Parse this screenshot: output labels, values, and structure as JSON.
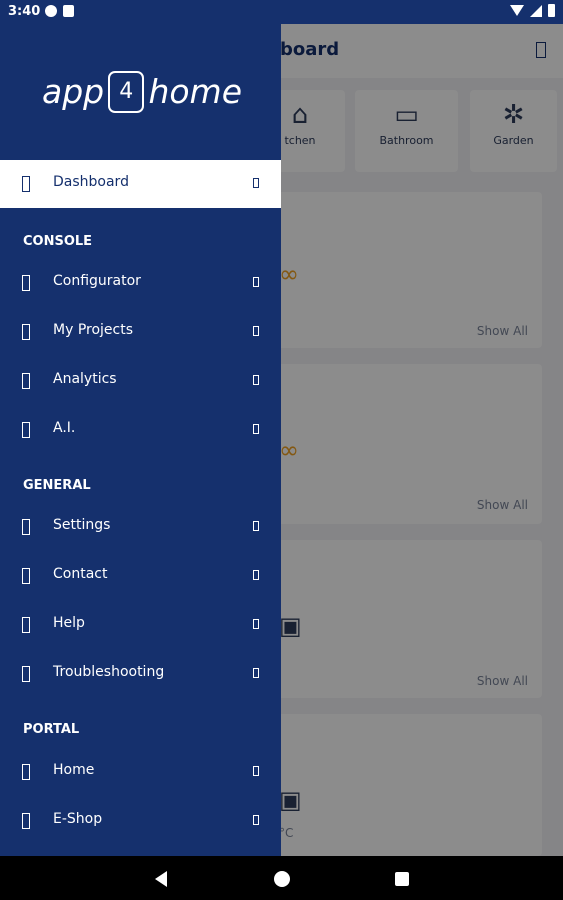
{
  "status_bar": {
    "time": "3:40"
  },
  "background": {
    "title": "board",
    "categories": [
      {
        "label": "tchen",
        "icon": "kitchen-icon"
      },
      {
        "label": "Bathroom",
        "icon": "bathtub-icon"
      },
      {
        "label": "Garden",
        "icon": "tree-icon"
      }
    ],
    "sections": [
      {
        "show_all": "Show All"
      },
      {
        "show_all": "Show All"
      },
      {
        "show_all": "Show All"
      }
    ],
    "partial_text": "°C"
  },
  "drawer": {
    "logo": {
      "left": "app",
      "mid": "4",
      "right": "home"
    },
    "active": "Dashboard",
    "sections": [
      {
        "title": "CONSOLE",
        "items": [
          "Configurator",
          "My Projects",
          "Analytics",
          "A.I."
        ]
      },
      {
        "title": "GENERAL",
        "items": [
          "Settings",
          "Contact",
          "Help",
          "Troubleshooting"
        ]
      },
      {
        "title": "PORTAL",
        "items": [
          "Home",
          "E-Shop"
        ]
      }
    ]
  },
  "colors": {
    "drawer": "#15306d",
    "accent": "#f0a020"
  }
}
